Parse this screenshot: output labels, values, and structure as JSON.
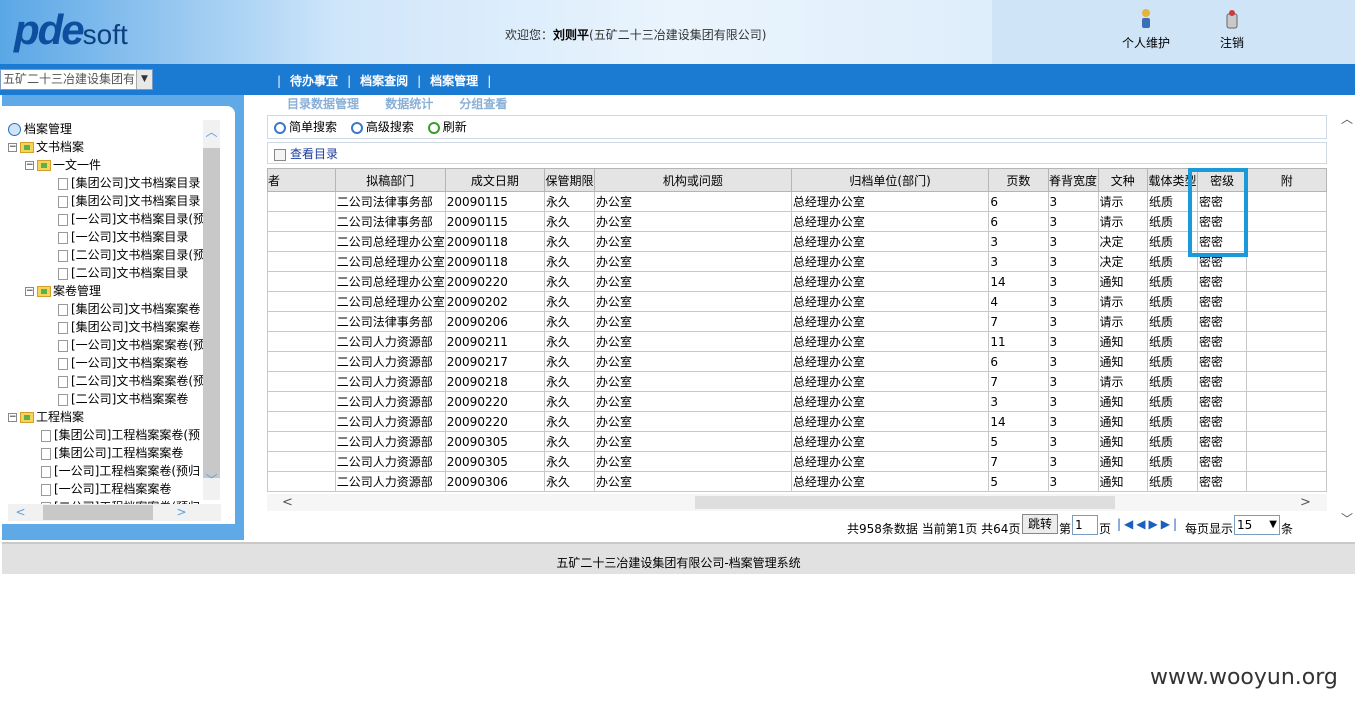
{
  "header": {
    "logo_bold": "pde",
    "logo_light": "soft",
    "welcome_prefix": "欢迎您：",
    "user_name": "刘则平",
    "org": "(五矿二十三冶建设集团有限公司)",
    "personal_label": "个人维护",
    "logout_label": "注销"
  },
  "nav": {
    "unit_select": "五矿二十三冶建设集团有",
    "menu": [
      "待办事宜",
      "档案查阅",
      "档案管理"
    ]
  },
  "tree": {
    "root": "档案管理",
    "nodes": [
      {
        "label": "文书档案",
        "level": 1,
        "type": "folder",
        "expand": "−"
      },
      {
        "label": "一文一件",
        "level": 2,
        "type": "folder",
        "expand": "−"
      },
      {
        "label": "[集团公司]文书档案目录",
        "level": 3,
        "type": "doc"
      },
      {
        "label": "[集团公司]文书档案目录",
        "level": 3,
        "type": "doc"
      },
      {
        "label": "[一公司]文书档案目录(预",
        "level": 3,
        "type": "doc"
      },
      {
        "label": "[一公司]文书档案目录",
        "level": 3,
        "type": "doc"
      },
      {
        "label": "[二公司]文书档案目录(预",
        "level": 3,
        "type": "doc"
      },
      {
        "label": "[二公司]文书档案目录",
        "level": 3,
        "type": "doc"
      },
      {
        "label": "案卷管理",
        "level": 2,
        "type": "folder",
        "expand": "−"
      },
      {
        "label": "[集团公司]文书档案案卷",
        "level": 3,
        "type": "doc"
      },
      {
        "label": "[集团公司]文书档案案卷",
        "level": 3,
        "type": "doc"
      },
      {
        "label": "[一公司]文书档案案卷(预",
        "level": 3,
        "type": "doc"
      },
      {
        "label": "[一公司]文书档案案卷",
        "level": 3,
        "type": "doc"
      },
      {
        "label": "[二公司]文书档案案卷(预",
        "level": 3,
        "type": "doc"
      },
      {
        "label": "[二公司]文书档案案卷",
        "level": 3,
        "type": "doc"
      },
      {
        "label": "工程档案",
        "level": 1,
        "type": "folder",
        "expand": "−"
      },
      {
        "label": "[集团公司]工程档案案卷(预",
        "level": 2,
        "type": "doc"
      },
      {
        "label": "[集团公司]工程档案案卷",
        "level": 2,
        "type": "doc"
      },
      {
        "label": "[一公司]工程档案案卷(预归",
        "level": 2,
        "type": "doc"
      },
      {
        "label": "[一公司]工程档案案卷",
        "level": 2,
        "type": "doc"
      },
      {
        "label": "[二公司]工程档案案卷(预归",
        "level": 2,
        "type": "doc"
      }
    ]
  },
  "main": {
    "subtabs": [
      "目录数据管理",
      "数据统计",
      "分组查看"
    ],
    "toolbar": {
      "simple_search": "简单搜索",
      "advanced_search": "高级搜索",
      "refresh": "刷新"
    },
    "view_catalog": "查看目录",
    "columns": [
      "者",
      "拟稿部门",
      "成文日期",
      "保管期限",
      "机构或问题",
      "归档单位(部门)",
      "页数",
      "脊背宽度",
      "文种",
      "载体类型",
      "密级",
      "附"
    ],
    "rows": [
      [
        "",
        "二公司法律事务部",
        "20090115",
        "永久",
        "办公室",
        "总经理办公室",
        "6",
        "3",
        "请示",
        "纸质",
        "密密",
        ""
      ],
      [
        "",
        "二公司法律事务部",
        "20090115",
        "永久",
        "办公室",
        "总经理办公室",
        "6",
        "3",
        "请示",
        "纸质",
        "密密",
        ""
      ],
      [
        "",
        "二公司总经理办公室",
        "20090118",
        "永久",
        "办公室",
        "总经理办公室",
        "3",
        "3",
        "决定",
        "纸质",
        "密密",
        ""
      ],
      [
        "",
        "二公司总经理办公室",
        "20090118",
        "永久",
        "办公室",
        "总经理办公室",
        "3",
        "3",
        "决定",
        "纸质",
        "密密",
        ""
      ],
      [
        "",
        "二公司总经理办公室",
        "20090220",
        "永久",
        "办公室",
        "总经理办公室",
        "14",
        "3",
        "通知",
        "纸质",
        "密密",
        ""
      ],
      [
        "",
        "二公司总经理办公室",
        "20090202",
        "永久",
        "办公室",
        "总经理办公室",
        "4",
        "3",
        "请示",
        "纸质",
        "密密",
        ""
      ],
      [
        "",
        "二公司法律事务部",
        "20090206",
        "永久",
        "办公室",
        "总经理办公室",
        "7",
        "3",
        "请示",
        "纸质",
        "密密",
        ""
      ],
      [
        "",
        "二公司人力资源部",
        "20090211",
        "永久",
        "办公室",
        "总经理办公室",
        "11",
        "3",
        "通知",
        "纸质",
        "密密",
        ""
      ],
      [
        "",
        "二公司人力资源部",
        "20090217",
        "永久",
        "办公室",
        "总经理办公室",
        "6",
        "3",
        "通知",
        "纸质",
        "密密",
        ""
      ],
      [
        "",
        "二公司人力资源部",
        "20090218",
        "永久",
        "办公室",
        "总经理办公室",
        "7",
        "3",
        "请示",
        "纸质",
        "密密",
        ""
      ],
      [
        "",
        "二公司人力资源部",
        "20090220",
        "永久",
        "办公室",
        "总经理办公室",
        "3",
        "3",
        "通知",
        "纸质",
        "密密",
        ""
      ],
      [
        "",
        "二公司人力资源部",
        "20090220",
        "永久",
        "办公室",
        "总经理办公室",
        "14",
        "3",
        "通知",
        "纸质",
        "密密",
        ""
      ],
      [
        "",
        "二公司人力资源部",
        "20090305",
        "永久",
        "办公室",
        "总经理办公室",
        "5",
        "3",
        "通知",
        "纸质",
        "密密",
        ""
      ],
      [
        "",
        "二公司人力资源部",
        "20090305",
        "永久",
        "办公室",
        "总经理办公室",
        "7",
        "3",
        "通知",
        "纸质",
        "密密",
        ""
      ],
      [
        "",
        "二公司人力资源部",
        "20090306",
        "永久",
        "办公室",
        "总经理办公室",
        "5",
        "3",
        "通知",
        "纸质",
        "密密",
        ""
      ]
    ]
  },
  "pager": {
    "summary": "共958条数据 当前第1页 共64页",
    "jump_label": "跳转",
    "page_prefix": "第",
    "page_value": "1",
    "page_suffix": "页",
    "per_page_label": "每页显示",
    "per_page_value": "15",
    "per_page_suffix": "条"
  },
  "footer": {
    "text": "五矿二十三冶建设集团有限公司-档案管理系统"
  },
  "watermark": "www.wooyun.org",
  "colors": {
    "nav_blue": "#1b7ad1",
    "highlight": "#1a9ad8",
    "panel_blue": "#5fa9e6"
  }
}
